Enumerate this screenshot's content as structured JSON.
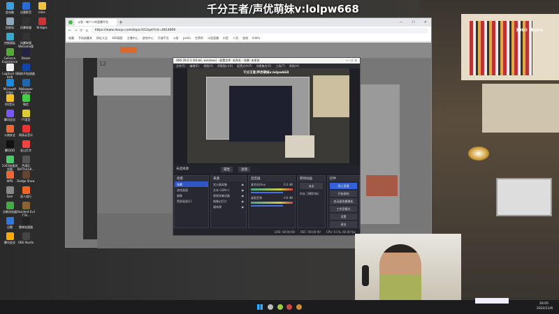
{
  "overlay_title": "千分王者/声优萌妹v:lolpw668",
  "desktop_icons": [
    "此电脑",
    "迅雷影音",
    "Inkle",
    "回收站",
    "风暴联盟",
    "Bridges",
    "控制面板",
    "风暴联盟 WeGame版",
    "GeForce Experience",
    "Steam",
    "Logitech G HUB",
    "网易UU加速器",
    "Microsoft Edge",
    "Wallpaper Engine",
    "QQ音乐",
    "微信",
    "腾讯会议",
    "YY语音",
    "火绒安全",
    "网易云音乐",
    "腾讯QQ",
    "金山打字",
    "2345加速浏览器",
    "PUBG BATTLEGR...",
    "WPS",
    "Dodge Show",
    "Sam",
    "双人成行",
    "谷歌浏览器",
    "Resident Evil 7 Bi...",
    "迅雷",
    "雷神加速器",
    "腾讯会议",
    "OBS Studio"
  ],
  "desktop_icon_colors": [
    "#3aa0e0",
    "#2a6bd8",
    "#f4c040",
    "#8ab",
    "#333",
    "#c33",
    "#3ac",
    "#333",
    "#5a3",
    "#224",
    "#eee",
    "#14a",
    "#1a8ae0",
    "#26a",
    "#f4c020",
    "#4c4",
    "#75f",
    "#dc3",
    "#e63",
    "#e33",
    "#111",
    "#e44",
    "#4c6",
    "#555",
    "#e63",
    "#643",
    "#888",
    "#e62",
    "#4a4",
    "#863",
    "#37d",
    "#222",
    "#fa0",
    "#444"
  ],
  "browser": {
    "tab_title": "斗鱼 - 每个人的直播平台",
    "url": "https://www.douyu.com/topic/S12qxt?rid=4814609",
    "bookmarks": [
      "收藏",
      "手机收藏夹",
      "网址大全",
      "360搜索",
      "主播中心",
      "游戏中心",
      "开放平台",
      "斗鱼",
      "yuhfu",
      "世界杯",
      "斗鱼直播",
      "抖音",
      "人资",
      "游戏",
      "lolhfu"
    ],
    "page_count": "12"
  },
  "obs": {
    "title": "OBS 28.0.3 (64-bit, windows) - 配置文件: 未命名 - 场景: 未命名",
    "menu": [
      "文件(F)",
      "编辑(E)",
      "视图(V)",
      "停靠窗口(D)",
      "配置文件(P)",
      "场景集合(S)",
      "工具(T)",
      "帮助(H)"
    ],
    "preview_title": "千分王者/声优萌妹v:lolpw668",
    "toolbar_label": "未选择源",
    "properties": "属性",
    "filters": "滤镜",
    "scenes_title": "场景",
    "scenes": [
      "场景",
      "游戏画面",
      "摄像",
      "黑屏画面(1)"
    ],
    "sources_title": "来源",
    "sources": [
      "显示器采集",
      "文本 (GDI+)",
      "视频采集设备",
      "图像幻灯片",
      "媒体源"
    ],
    "mixer_title": "混音器",
    "mixer": [
      {
        "name": "麦克风/Aux",
        "db": "0.0 dB"
      },
      {
        "name": "桌面音频",
        "db": "0.0 dB"
      }
    ],
    "transition_title": "转场动画",
    "transition": "淡出",
    "duration_label": "时长",
    "duration": "300 ms",
    "controls_title": "控件",
    "controls": [
      "停止直播",
      "开始录制",
      "启动虚拟摄像机",
      "工作室模式",
      "设置",
      "退出"
    ],
    "status": {
      "live": "LIVE: 00:00:00",
      "rec": "REC: 00:00:00",
      "cpu": "CPU: 0.1%, 60.00 fps"
    }
  },
  "room": {
    "book_label": "1000 chairs"
  },
  "taskbar": {
    "time": "20:05",
    "date": "2022/11/6"
  }
}
